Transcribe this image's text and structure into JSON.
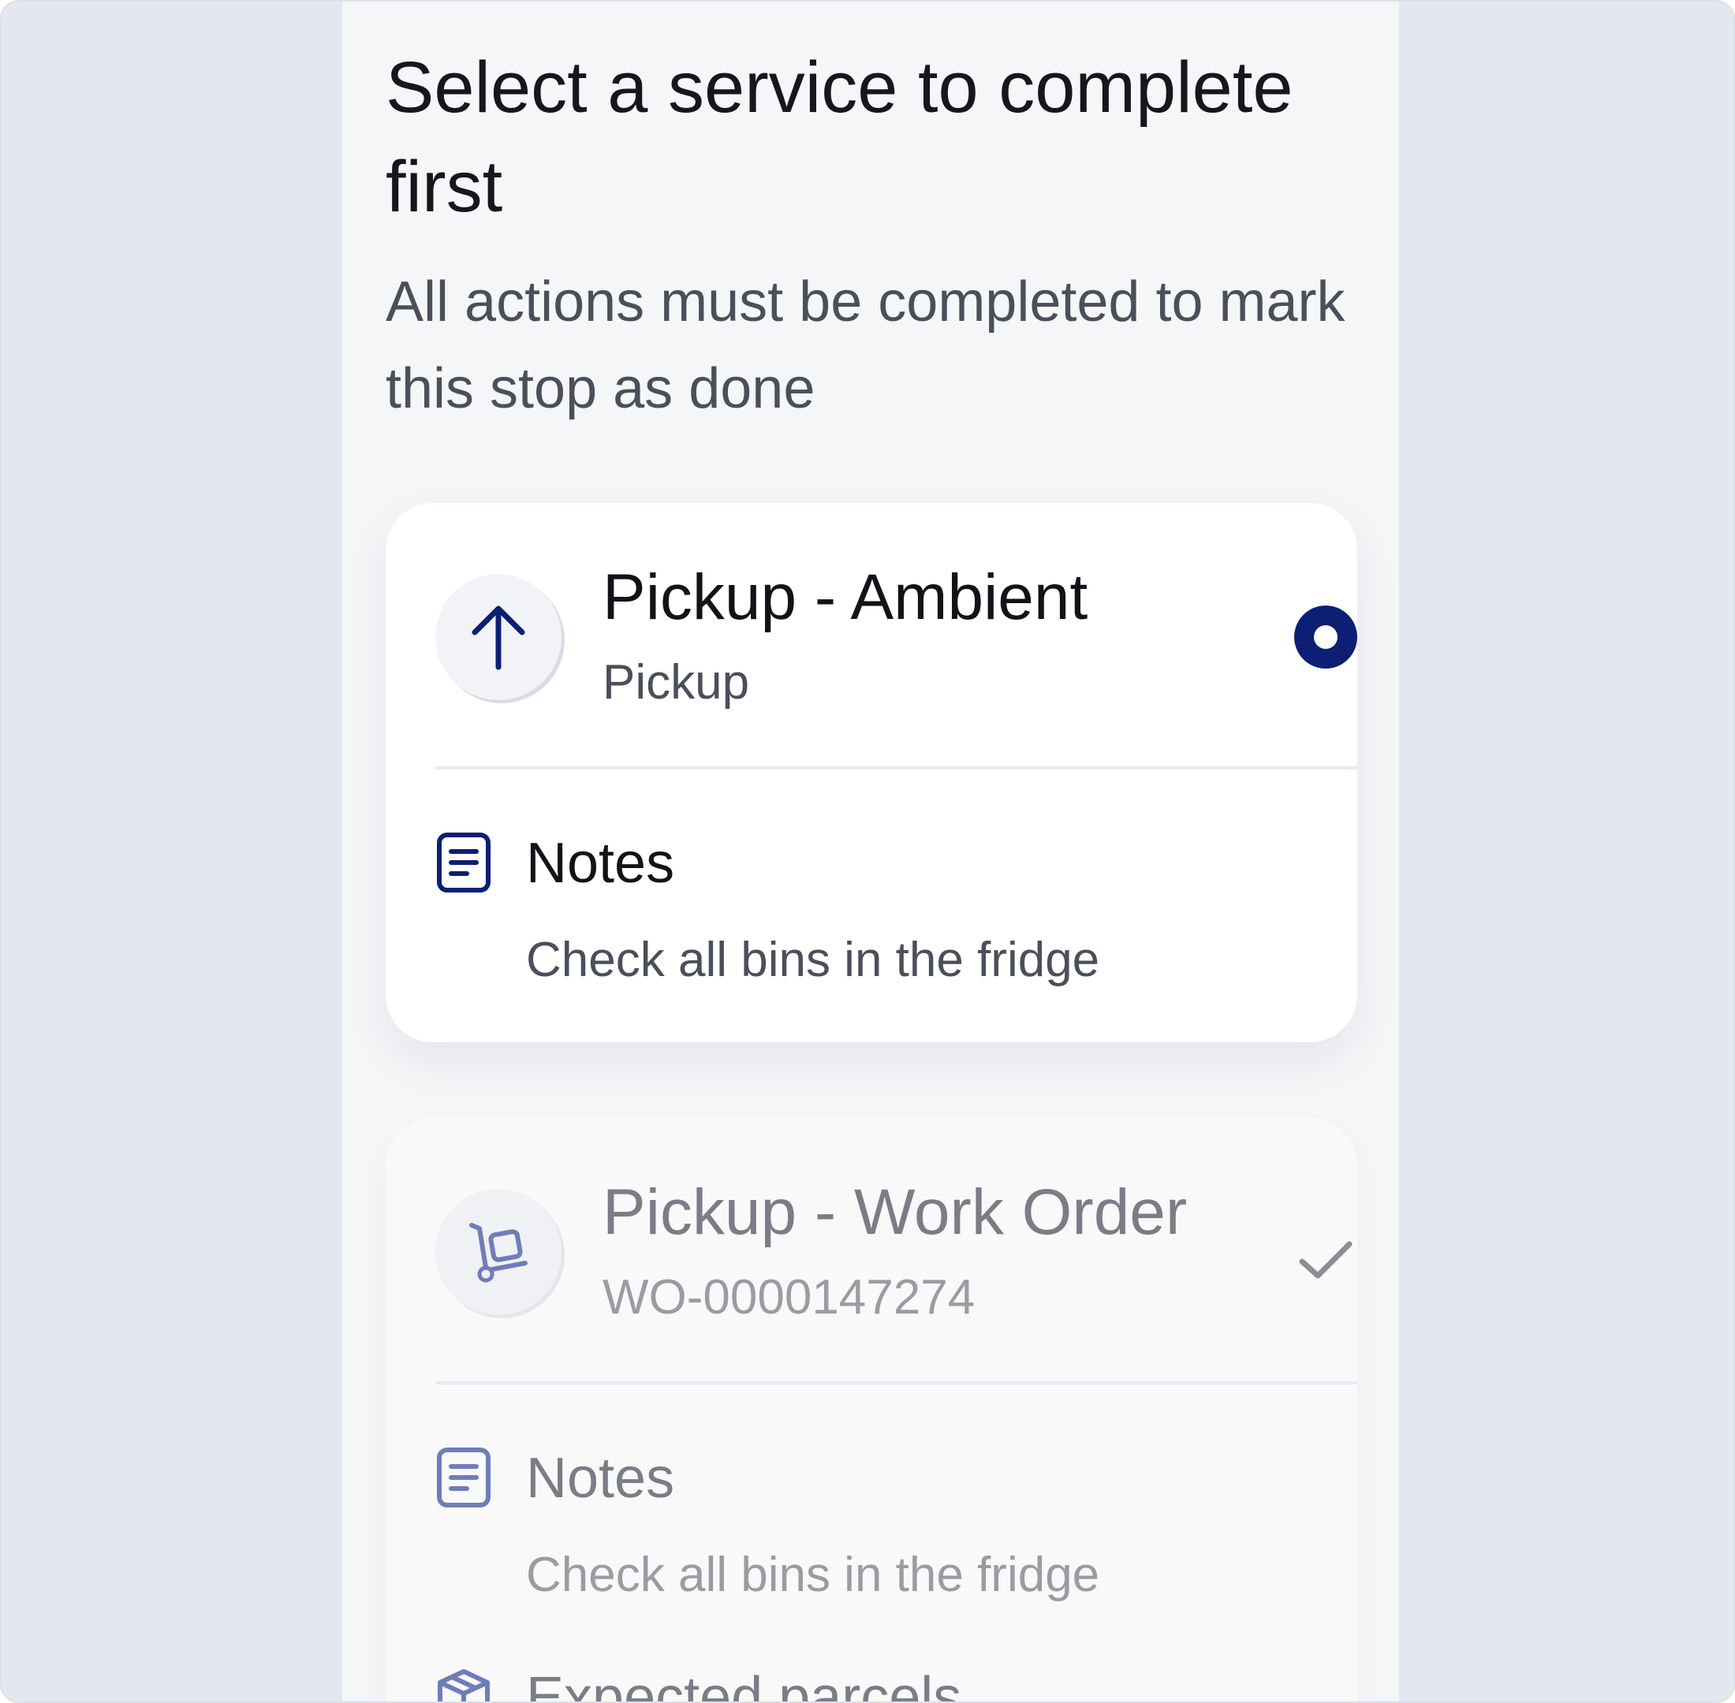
{
  "page": {
    "heading": "Select a service to complete first",
    "subheading": "All actions must be completed to mark this stop as done"
  },
  "services": [
    {
      "title": "Pickup - Ambient",
      "subtitle": "Pickup",
      "icon": "arrow-up-icon",
      "state": "selected",
      "notes_label": "Notes",
      "notes_text": "Check all bins in the fridge"
    },
    {
      "title": "Pickup - Work Order",
      "subtitle": "WO-0000147274",
      "icon": "hand-truck-icon",
      "state": "completed",
      "notes_label": "Notes",
      "notes_text": "Check all bins in the fridge",
      "parcels_label": "Expected parcels",
      "parcels_icon": "package-icon"
    }
  ],
  "colors": {
    "accent": "#0c1f74",
    "icon_muted": "#6f7db8",
    "check": "#8c8e94"
  }
}
